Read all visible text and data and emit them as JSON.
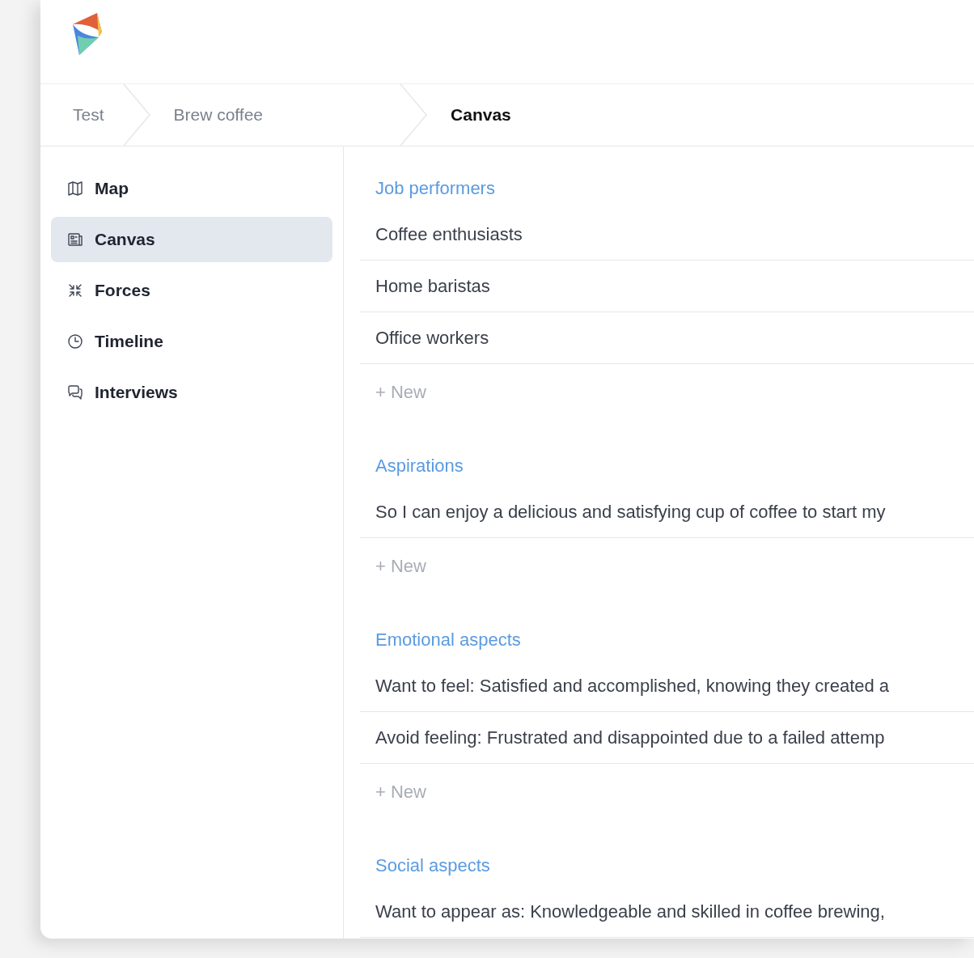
{
  "breadcrumbs": [
    {
      "label": "Test",
      "current": false
    },
    {
      "label": "Brew coffee",
      "current": false
    },
    {
      "label": "Canvas",
      "current": true
    }
  ],
  "sidebar": {
    "items": [
      {
        "label": "Map",
        "kind": "map",
        "selected": false
      },
      {
        "label": "Canvas",
        "kind": "canvas",
        "selected": true
      },
      {
        "label": "Forces",
        "kind": "forces",
        "selected": false
      },
      {
        "label": "Timeline",
        "kind": "timeline",
        "selected": false
      },
      {
        "label": "Interviews",
        "kind": "interviews",
        "selected": false
      }
    ]
  },
  "sections": [
    {
      "title": "Job performers",
      "items": [
        "Coffee enthusiasts",
        "Home baristas",
        "Office workers"
      ],
      "add_label": "+ New"
    },
    {
      "title": "Aspirations",
      "items": [
        "So I can enjoy a delicious and satisfying cup of coffee to start my"
      ],
      "add_label": "+ New"
    },
    {
      "title": "Emotional aspects",
      "items": [
        "Want to feel: Satisfied and accomplished, knowing they created a",
        "Avoid feeling: Frustrated and disappointed due to a failed attemp"
      ],
      "add_label": "+ New"
    },
    {
      "title": "Social aspects",
      "items": [
        "Want to appear as: Knowledgeable and skilled in coffee brewing,"
      ]
    }
  ]
}
